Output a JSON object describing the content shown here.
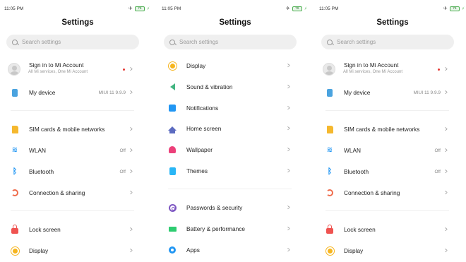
{
  "status": {
    "time": "11:05 PM",
    "battery": "79"
  },
  "title": "Settings",
  "search_placeholder": "Search settings",
  "main_list": {
    "account": {
      "label": "Sign in to Mi Account",
      "sub": "All Mi services, One Mi Account"
    },
    "my_device": {
      "label": "My device",
      "value": "MIUI 11 9.9.9"
    },
    "sim": {
      "label": "SIM cards & mobile networks"
    },
    "wlan": {
      "label": "WLAN",
      "value": "Off"
    },
    "bluetooth": {
      "label": "Bluetooth",
      "value": "Off"
    },
    "connection": {
      "label": "Connection & sharing"
    },
    "lock": {
      "label": "Lock screen"
    },
    "display": {
      "label": "Display"
    }
  },
  "middle_list": {
    "display": {
      "label": "Display"
    },
    "sound": {
      "label": "Sound & vibration"
    },
    "notifications": {
      "label": "Notifications"
    },
    "home": {
      "label": "Home screen"
    },
    "wallpaper": {
      "label": "Wallpaper"
    },
    "themes": {
      "label": "Themes"
    },
    "passwords": {
      "label": "Passwords & security"
    },
    "battery": {
      "label": "Battery & performance"
    },
    "apps": {
      "label": "Apps"
    }
  },
  "chevron": ">",
  "icons": [
    "device-icon",
    "sim-icon",
    "wifi-icon",
    "bluetooth-icon",
    "connection-icon",
    "lock-icon",
    "sun-icon",
    "sound-icon",
    "notification-icon",
    "home-icon",
    "wallpaper-icon",
    "themes-icon",
    "password-icon",
    "battery-icon",
    "apps-icon"
  ]
}
